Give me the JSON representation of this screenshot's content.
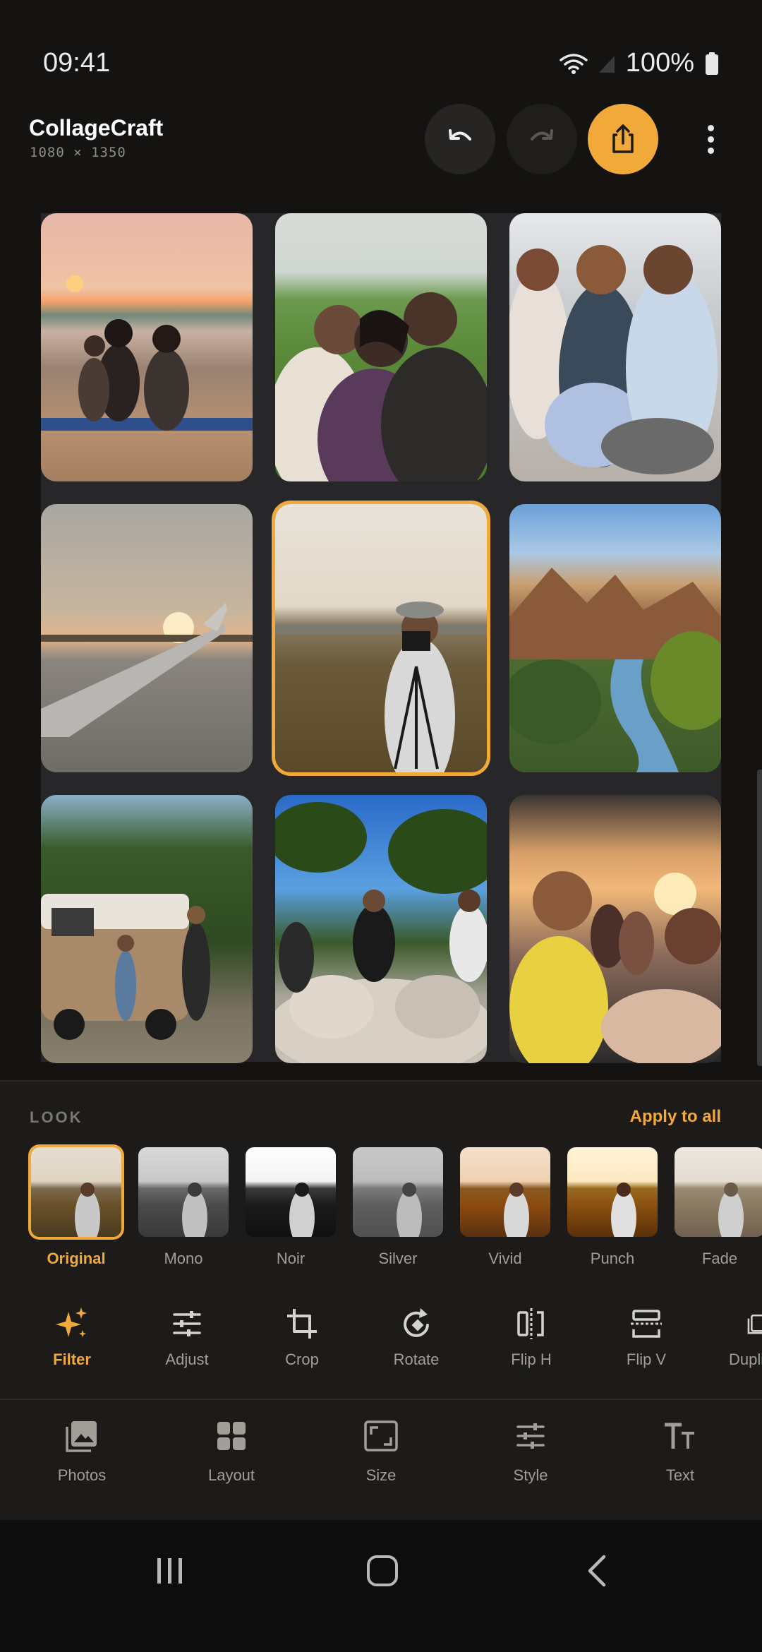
{
  "status": {
    "time": "09:41",
    "battery": "100%"
  },
  "header": {
    "title": "CollageCraft",
    "dimensions": "1080 × 1350",
    "icons": {
      "undo": "undo-icon",
      "redo": "redo-icon",
      "share": "share-icon",
      "more": "more-vertical-icon"
    }
  },
  "canvas": {
    "cells": [
      "friends-at-beach-sunset",
      "friends-laughing-outdoors",
      "friends-sitting-together",
      "airplane-wing-sunset",
      "photographer-in-field",
      "canyon-river-landscape",
      "camper-van-in-forest",
      "friends-on-rocks",
      "friends-in-car-selfie"
    ],
    "selected_index": 4
  },
  "look": {
    "label": "LOOK",
    "apply_all": "Apply to all",
    "filters": [
      "Original",
      "Mono",
      "Noir",
      "Silver",
      "Vivid",
      "Punch",
      "Fade"
    ],
    "selected": "Original"
  },
  "tools": [
    "Filter",
    "Adjust",
    "Crop",
    "Rotate",
    "Flip H",
    "Flip V",
    "Dupli"
  ],
  "nav": [
    "Photos",
    "Layout",
    "Size",
    "Style",
    "Text"
  ],
  "colors": {
    "accent": "#f1a93a",
    "background": "#141312",
    "sheet": "#1c1b19"
  }
}
